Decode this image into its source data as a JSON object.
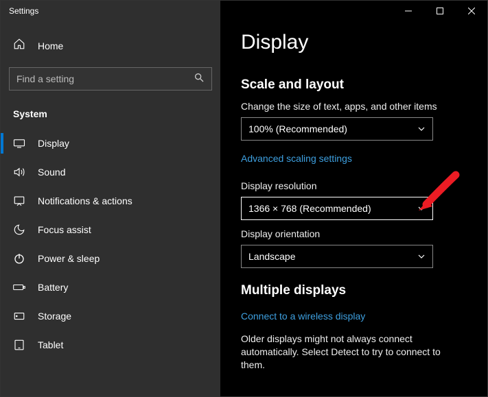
{
  "window": {
    "title": "Settings"
  },
  "sidebar": {
    "home_label": "Home",
    "search_placeholder": "Find a setting",
    "section_title": "System",
    "items": [
      {
        "label": "Display"
      },
      {
        "label": "Sound"
      },
      {
        "label": "Notifications & actions"
      },
      {
        "label": "Focus assist"
      },
      {
        "label": "Power & sleep"
      },
      {
        "label": "Battery"
      },
      {
        "label": "Storage"
      },
      {
        "label": "Tablet"
      }
    ]
  },
  "page": {
    "title": "Display",
    "scale_heading": "Scale and layout",
    "scale_label": "Change the size of text, apps, and other items",
    "scale_value": "100% (Recommended)",
    "advanced_link": "Advanced scaling settings",
    "resolution_label": "Display resolution",
    "resolution_value": "1366 × 768 (Recommended)",
    "orientation_label": "Display orientation",
    "orientation_value": "Landscape",
    "multi_heading": "Multiple displays",
    "wireless_link": "Connect to a wireless display",
    "multi_desc": "Older displays might not always connect automatically. Select Detect to try to connect to them."
  },
  "colors": {
    "accent": "#0078d4",
    "link": "#3ea0e0",
    "arrow": "#ec1c24"
  }
}
